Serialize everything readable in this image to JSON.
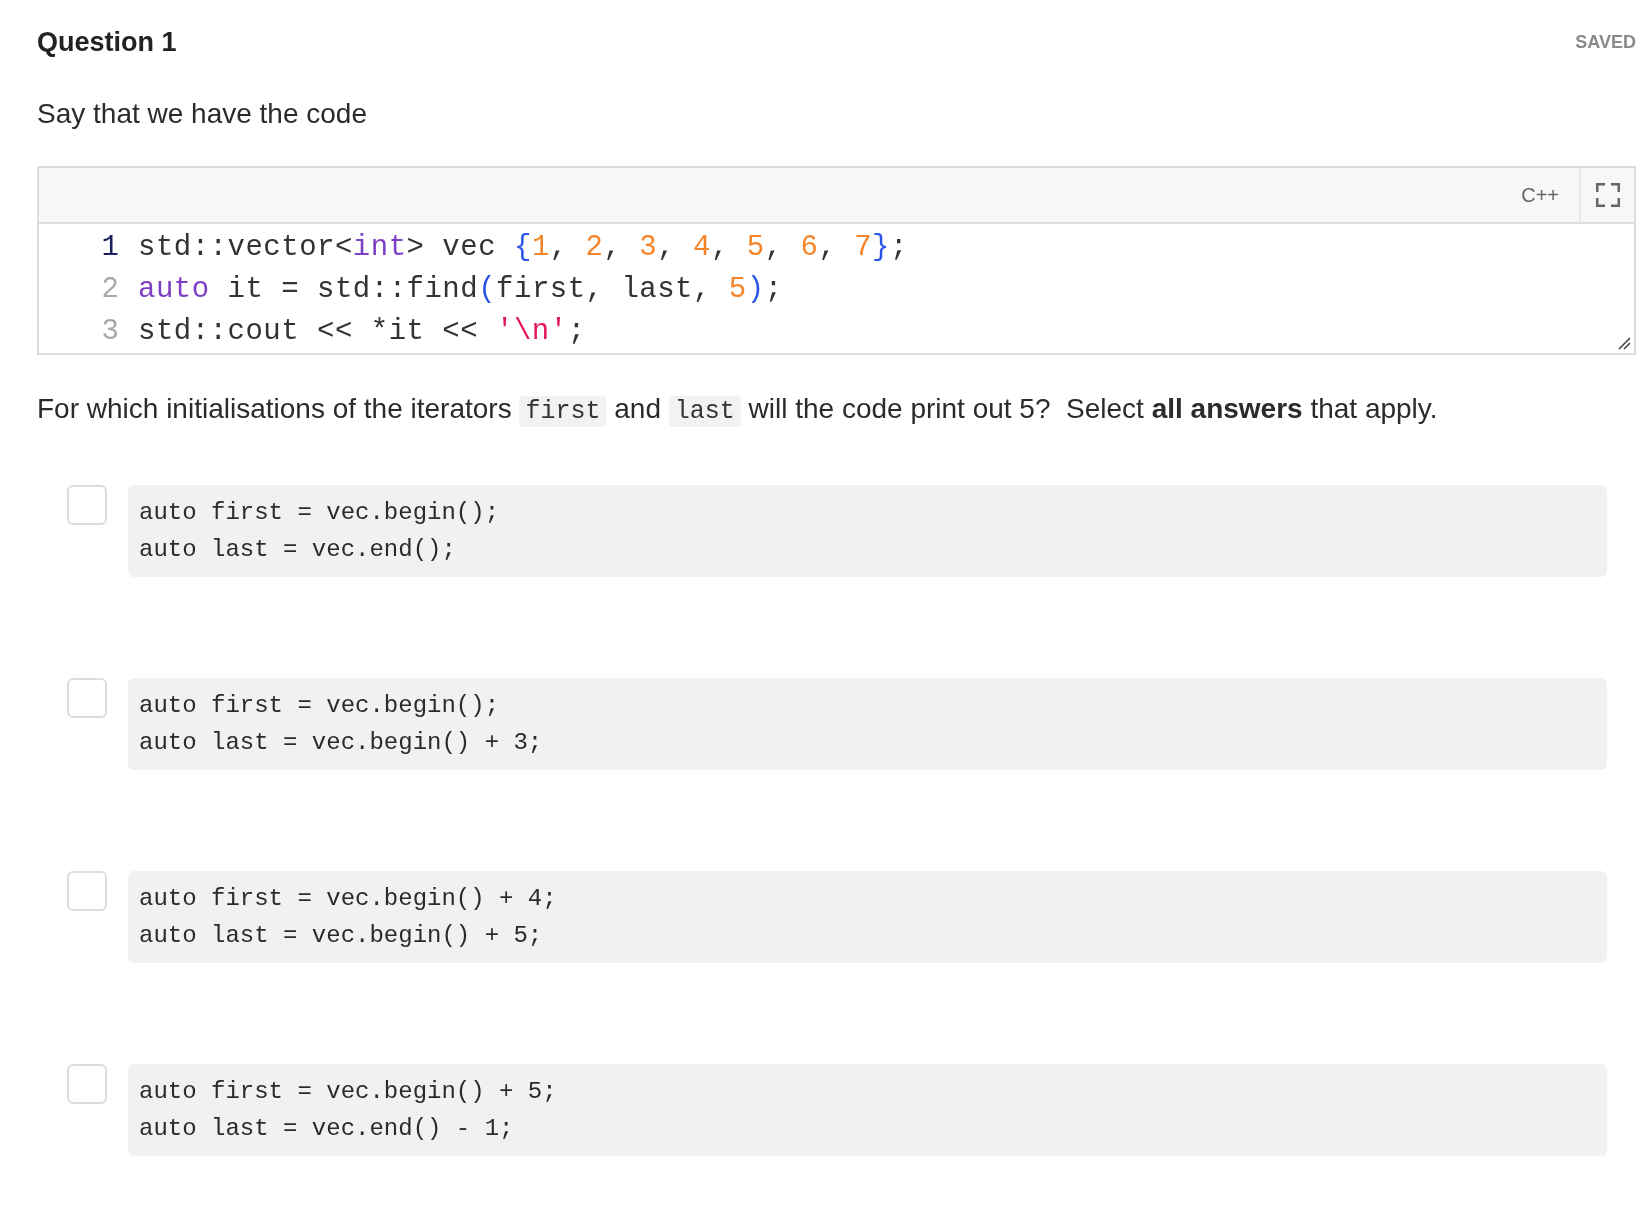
{
  "question": {
    "title": "Question 1",
    "status": "SAVED"
  },
  "intro": "Say that we have the code",
  "code_editor": {
    "language": "C++",
    "lines": [
      {
        "number": "1",
        "active": true,
        "tokens": [
          {
            "kind": "plain",
            "text": "std::vector<"
          },
          {
            "kind": "keyword",
            "text": "int"
          },
          {
            "kind": "plain",
            "text": "> vec "
          },
          {
            "kind": "bracket",
            "text": "{"
          },
          {
            "kind": "number",
            "text": "1"
          },
          {
            "kind": "plain",
            "text": ", "
          },
          {
            "kind": "number",
            "text": "2"
          },
          {
            "kind": "plain",
            "text": ", "
          },
          {
            "kind": "number",
            "text": "3"
          },
          {
            "kind": "plain",
            "text": ", "
          },
          {
            "kind": "number",
            "text": "4"
          },
          {
            "kind": "plain",
            "text": ", "
          },
          {
            "kind": "number",
            "text": "5"
          },
          {
            "kind": "plain",
            "text": ", "
          },
          {
            "kind": "number",
            "text": "6"
          },
          {
            "kind": "plain",
            "text": ", "
          },
          {
            "kind": "number",
            "text": "7"
          },
          {
            "kind": "bracket",
            "text": "}"
          },
          {
            "kind": "plain",
            "text": ";"
          }
        ]
      },
      {
        "number": "2",
        "active": false,
        "tokens": [
          {
            "kind": "keyword",
            "text": "auto"
          },
          {
            "kind": "plain",
            "text": " it = std::find"
          },
          {
            "kind": "bracket",
            "text": "("
          },
          {
            "kind": "plain",
            "text": "first, last, "
          },
          {
            "kind": "number",
            "text": "5"
          },
          {
            "kind": "bracket",
            "text": ")"
          },
          {
            "kind": "plain",
            "text": ";"
          }
        ]
      },
      {
        "number": "3",
        "active": false,
        "tokens": [
          {
            "kind": "plain",
            "text": "std::cout << *it << "
          },
          {
            "kind": "string",
            "text": "'\\n'"
          },
          {
            "kind": "plain",
            "text": ";"
          }
        ]
      }
    ]
  },
  "prompt": [
    {
      "kind": "text",
      "text": "For which initialisations of the iterators "
    },
    {
      "kind": "code",
      "text": "first"
    },
    {
      "kind": "text",
      "text": " and "
    },
    {
      "kind": "code",
      "text": "last"
    },
    {
      "kind": "text",
      "text": " will the code print out 5?  Select **all answers** that apply."
    }
  ],
  "options": [
    {
      "checked": false,
      "lines": [
        "auto first = vec.begin();",
        "auto last = vec.end();"
      ]
    },
    {
      "checked": false,
      "lines": [
        "auto first = vec.begin();",
        "auto last = vec.begin() + 3;"
      ]
    },
    {
      "checked": false,
      "lines": [
        "auto first = vec.begin() + 4;",
        "auto last = vec.begin() + 5;"
      ]
    },
    {
      "checked": false,
      "lines": [
        "auto first = vec.begin() + 5;",
        "auto last = vec.end() - 1;"
      ]
    }
  ]
}
